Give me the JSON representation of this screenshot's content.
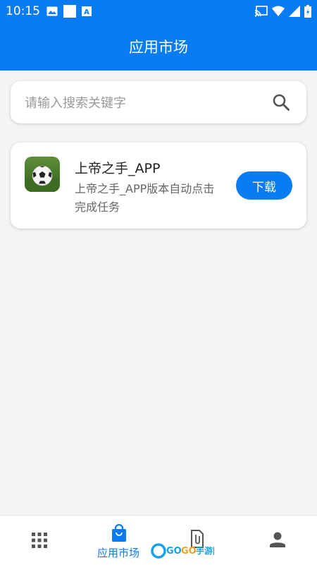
{
  "status_bar": {
    "time": "10:15",
    "left_icons": [
      "image-icon",
      "square-icon",
      "a-badge-icon"
    ],
    "right_icons": [
      "cast-icon",
      "wifi-icon",
      "signal-icon",
      "battery-icon"
    ]
  },
  "app_bar": {
    "title": "应用市场"
  },
  "search": {
    "placeholder": "请输入搜索关键字",
    "value": "",
    "icon": "search-icon"
  },
  "apps": [
    {
      "name": "上帝之手_APP",
      "description": "上帝之手_APP版本自动点击完成任务",
      "button_label": "下载",
      "icon": "soccer-ball-icon"
    }
  ],
  "bottom_nav": {
    "items": [
      {
        "icon": "grid-icon",
        "label": ""
      },
      {
        "icon": "shopping-bag-icon",
        "label": "应用市场",
        "active": true
      },
      {
        "icon": "document-icon",
        "label": ""
      },
      {
        "icon": "person-icon",
        "label": ""
      }
    ]
  },
  "colors": {
    "primary": "#0a7cf2",
    "background": "#f4f4f4",
    "card": "#ffffff"
  }
}
